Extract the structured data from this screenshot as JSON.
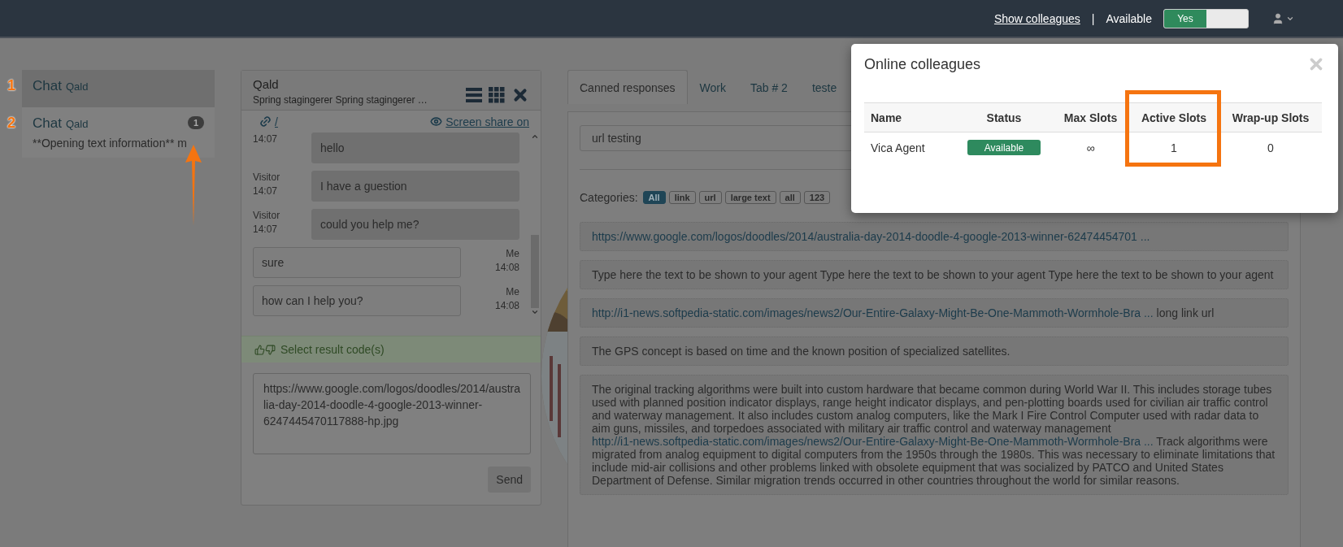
{
  "navbar": {
    "colleagues_link": "Show colleagues",
    "separator": "|",
    "status_label": "Available",
    "toggle": {
      "label": "Yes",
      "on": true
    }
  },
  "chats": [
    {
      "marker": "1",
      "title": "Chat",
      "subtitle": "Qald",
      "selected": true
    },
    {
      "marker": "2",
      "title": "Chat",
      "subtitle": "Qald",
      "preview": "**Opening text information** m",
      "badge": "1",
      "selected": false,
      "arrow": true
    }
  ],
  "chat_window": {
    "title": "Qald",
    "subtitle": "Spring stagingerer Spring stagingerer …",
    "link_text": "/",
    "screen_share": "Screen share on",
    "messages": [
      {
        "kind": "visitor",
        "time": "14:07",
        "text": "hello"
      },
      {
        "kind": "visitor",
        "author": "Visitor",
        "time": "14:07",
        "text": "I have a guestion"
      },
      {
        "kind": "visitor",
        "author": "Visitor",
        "time": "14:07",
        "text": "could you help me?"
      },
      {
        "kind": "me",
        "author": "Me",
        "time": "14:08",
        "text": "sure"
      },
      {
        "kind": "me",
        "author": "Me",
        "time": "14:08",
        "text": "how can I help you?"
      }
    ],
    "result_code": "Select result code(s)",
    "draft": "https://www.google.com/logos/doodles/2014/australia-day-2014-doodle-4-google-2013-winner-6247445470117888-hp.jpg",
    "send": "Send"
  },
  "tabs": [
    {
      "label": "Canned responses",
      "selected": true
    },
    {
      "label": "Work",
      "selected": false
    },
    {
      "label": "Tab # 2",
      "selected": false
    },
    {
      "label": "teste",
      "selected": false
    }
  ],
  "canned": {
    "search_value": "url testing",
    "categories_label": "Categories:",
    "categories": [
      {
        "label": "All",
        "selected": true
      },
      {
        "label": "link",
        "selected": false
      },
      {
        "label": "url",
        "selected": false
      },
      {
        "label": "large text",
        "selected": false
      },
      {
        "label": "all",
        "selected": false
      },
      {
        "label": "123",
        "selected": false
      }
    ],
    "items": [
      {
        "segments": [
          {
            "kind": "link",
            "text": "https://www.google.com/logos/doodles/2014/australia-day-2014-doodle-4-google-2013-winner-62474454701 ..."
          }
        ]
      },
      {
        "segments": [
          {
            "kind": "text",
            "text": "Type here the text to be shown to your agent Type here the text to be shown to your agent Type here the text to be shown to your agent"
          }
        ]
      },
      {
        "segments": [
          {
            "kind": "link",
            "text": "http://i1-news.softpedia-static.com/images/news2/Our-Entire-Galaxy-Might-Be-One-Mammoth-Wormhole-Bra ..."
          },
          {
            "kind": "text",
            "text": "long link url"
          }
        ]
      },
      {
        "segments": [
          {
            "kind": "text",
            "text": "The GPS concept is based on time and the known position of specialized satellites."
          }
        ]
      },
      {
        "segments": [
          {
            "kind": "text",
            "text": "The original tracking algorithms were built into custom hardware that became common during World War II. This includes storage tubes used with planned position indicator displays, range height indicator displays, and pen-plotting boards used for civilian air traffic control and waterway management. It also includes custom analog computers, like the Mark I Fire Control Computer used with radar data to aim guns, missiles, and torpedoes associated with military air traffic control and waterway management"
          },
          {
            "kind": "link",
            "text": "http://i1-news.softpedia-static.com/images/news2/Our-Entire-Galaxy-Might-Be-One-Mammoth-Wormhole-Bra ..."
          },
          {
            "kind": "text",
            "text": "Track algorithms were migrated from analog equipment to digital computers from the 1950s through the 1980s. This was necessary to eliminate limitations that include mid-air collisions and other problems linked with obsolete equipment that was socialized by PATCO and United States Department of Defense. Similar migration trends occurred in other countries throughout the world for similar reasons."
          }
        ]
      }
    ]
  },
  "modal": {
    "title": "Online colleagues",
    "columns": [
      {
        "label": "Name",
        "highlighted": false
      },
      {
        "label": "Status",
        "highlighted": false
      },
      {
        "label": "Max Slots",
        "highlighted": false
      },
      {
        "label": "Active Slots",
        "highlighted": true
      },
      {
        "label": "Wrap-up Slots",
        "highlighted": false
      }
    ],
    "rows": [
      {
        "name": "Vica Agent",
        "status": {
          "label": "Available",
          "kind": "available"
        },
        "max_slots": "∞",
        "active_slots": "1",
        "wrap_up_slots": "0"
      }
    ]
  }
}
